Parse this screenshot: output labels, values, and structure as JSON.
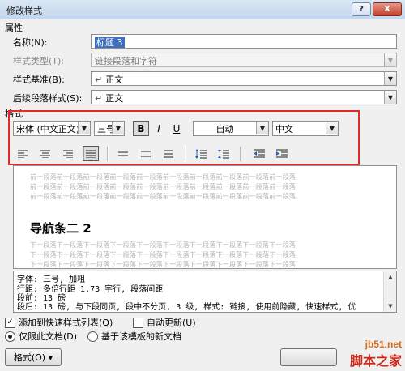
{
  "window": {
    "title": "修改样式",
    "help_label": "?",
    "close_label": "X"
  },
  "properties": {
    "section_label": "属性",
    "name_label": "名称(N):",
    "name_value": "标题 3",
    "style_type_label": "样式类型(T):",
    "style_type_value": "链接段落和字符",
    "based_on_label": "样式基准(B):",
    "based_on_value": "正文",
    "following_label": "后续段落样式(S):",
    "following_value": "正文"
  },
  "format": {
    "section_label": "格式",
    "font_value": "宋体 (中文正文)",
    "size_value": "三号",
    "bold_label": "B",
    "italic_label": "I",
    "underline_label": "U",
    "color_value": "自动",
    "language_value": "中文"
  },
  "preview": {
    "prev_line_1": "前一段落前一段落前一段落前一段落前一段落前一段落前一段落前一段落前一段落前一段落",
    "prev_line_2": "前一段落前一段落前一段落前一段落前一段落前一段落前一段落前一段落前一段落前一段落",
    "prev_line_3": "前一段落前一段落前一段落前一段落前一段落前一段落前一段落前一段落前一段落前一段落",
    "sample_text": "导航条二 2",
    "next_line_1": "下一段落下一段落下一段落下一段落下一段落下一段落下一段落下一段落下一段落下一段落",
    "next_line_2": "下一段落下一段落下一段落下一段落下一段落下一段落下一段落下一段落下一段落下一段落",
    "next_line_3": "下一段落下一段落下一段落下一段落下一段落下一段落下一段落下一段落下一段落下一段落"
  },
  "description": {
    "line_1": "字体: 三号, 加粗",
    "line_2": "    行距: 多倍行距 1.73 字行, 段落间距",
    "line_3": "    段前: 13 磅",
    "line_4": "    段后: 13 磅, 与下段同页, 段中不分页, 3 级, 样式: 链接, 使用前隐藏, 快速样式, 优"
  },
  "options": {
    "add_to_quick_label": "添加到快速样式列表(Q)",
    "auto_update_label": "自动更新(U)",
    "only_this_doc_label": "仅限此文档(D)",
    "new_docs_label": "基于该模板的新文档",
    "add_to_quick_checked": true,
    "auto_update_checked": false,
    "selected_scope": "only_this_doc"
  },
  "buttons": {
    "format_label": "格式(O) ▾"
  },
  "watermark": {
    "domain": "jb51.net",
    "name": "脚本之家"
  },
  "icons": {
    "chevron": "chevron-down-icon",
    "link": "link-mark-icon"
  }
}
